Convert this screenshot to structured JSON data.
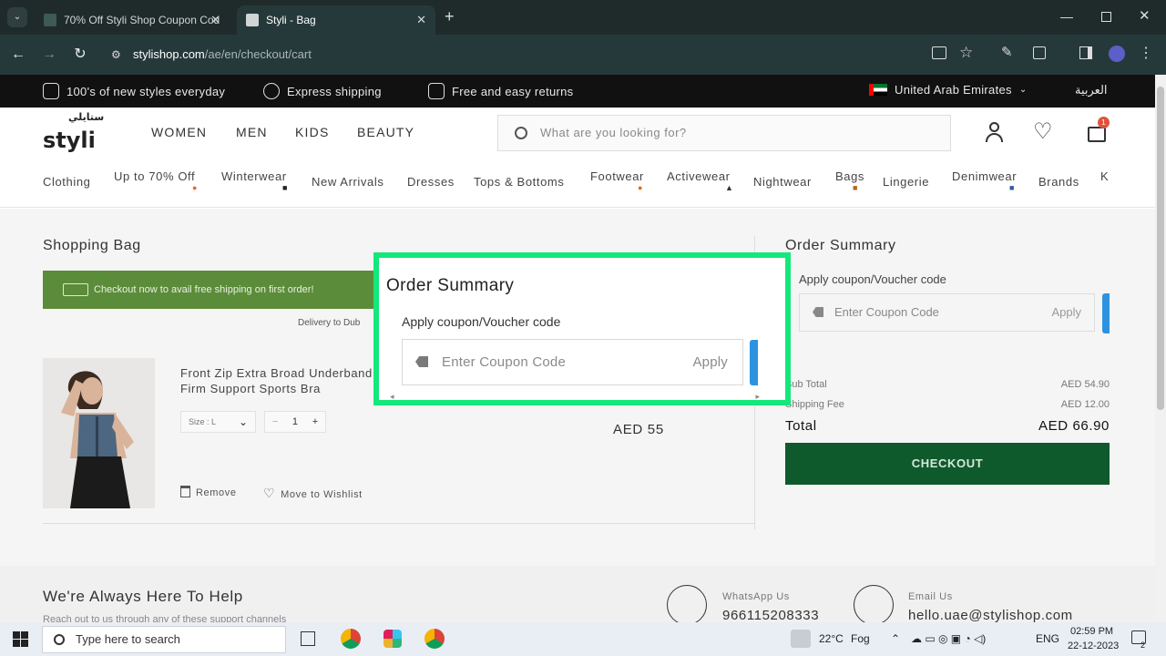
{
  "browser": {
    "tabs": [
      {
        "label": "70% Off Styli Shop Coupon Cod",
        "active": false
      },
      {
        "label": "Styli - Bag",
        "active": true
      }
    ],
    "url_host": "stylishop.com",
    "url_path": "/ae/en/checkout/cart"
  },
  "infobar": {
    "item1": "100's of new styles everyday",
    "item2": "Express shipping",
    "item3": "Free and easy returns",
    "country": "United Arab Emirates",
    "language": "العربية"
  },
  "header": {
    "logo": "styli",
    "logo_arabic": "ستايلي",
    "nav": [
      "WOMEN",
      "MEN",
      "KIDS",
      "BEAUTY"
    ],
    "search_placeholder": "What are you looking for?",
    "cart_count": "1"
  },
  "categories": [
    "Clothing",
    "Up to 70% Off",
    "Winterwear",
    "New Arrivals",
    "Dresses",
    "Tops & Bottoms",
    "Footwear",
    "Activewear",
    "Nightwear",
    "Bags",
    "Lingerie",
    "Denimwear",
    "Brands",
    "K"
  ],
  "bag": {
    "title": "Shopping Bag",
    "banner": "Checkout now to avail free shipping on first order!",
    "delivery": "Delivery to Dub",
    "product_name": "Front Zip Extra Broad Underband Firm Support Sports Bra",
    "size": "Size : L",
    "qty": "1",
    "price": "AED 55",
    "remove": "Remove",
    "wishlist": "Move to Wishlist"
  },
  "summary": {
    "title": "Order Summary",
    "coupon_label": "Apply coupon/Voucher code",
    "coupon_placeholder": "Enter Coupon Code",
    "apply": "Apply",
    "subtotal_label": "Sub Total",
    "subtotal": "AED 54.90",
    "shipping_label": "Shipping Fee",
    "shipping": "AED 12.00",
    "total_label": "Total",
    "total": "AED 66.90",
    "checkout": "CHECKOUT"
  },
  "footer": {
    "title": "We're Always Here To Help",
    "subtitle": "Reach out to us through any of these support channels",
    "whatsapp_label": "WhatsApp Us",
    "whatsapp": "966115208333",
    "email_label": "Email Us",
    "email": "hello.uae@stylishop.com"
  },
  "taskbar": {
    "search_placeholder": "Type here to search",
    "weather_temp": "22°C",
    "weather": "Fog",
    "lang": "ENG",
    "time": "02:59 PM",
    "date": "22-12-2023",
    "notif": "2"
  },
  "zoom": {
    "title": "Order Summary",
    "coupon_label": "Apply coupon/Voucher code",
    "coupon_placeholder": "Enter Coupon Code",
    "apply": "Apply"
  },
  "colors": {
    "highlight": "#13e87a",
    "checkout_bg": "#0f5a2c",
    "banner_bg": "#5b8c3a",
    "accent_blue": "#2d93e0"
  }
}
